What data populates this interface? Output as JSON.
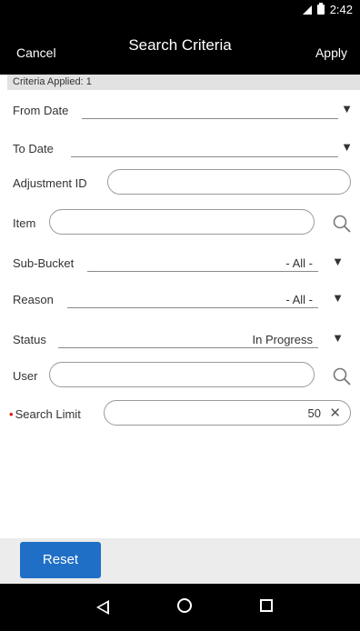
{
  "status_bar": {
    "time": "2:42"
  },
  "app_bar": {
    "cancel": "Cancel",
    "title": "Search Criteria",
    "apply": "Apply"
  },
  "criteria_applied": "Criteria Applied: 1",
  "fields": {
    "from_date": {
      "label": "From Date"
    },
    "to_date": {
      "label": "To Date"
    },
    "adjustment_id": {
      "label": "Adjustment ID",
      "value": ""
    },
    "item": {
      "label": "Item",
      "value": ""
    },
    "sub_bucket": {
      "label": "Sub-Bucket",
      "value": "- All -"
    },
    "reason": {
      "label": "Reason",
      "value": "- All -"
    },
    "status": {
      "label": "Status",
      "value": "In Progress"
    },
    "user": {
      "label": "User",
      "value": ""
    },
    "search_limit": {
      "label": "Search Limit",
      "value": "50",
      "required_marker": "•"
    }
  },
  "buttons": {
    "reset": "Reset"
  },
  "icons": {
    "dropdown": "▼",
    "clear": "✕"
  }
}
